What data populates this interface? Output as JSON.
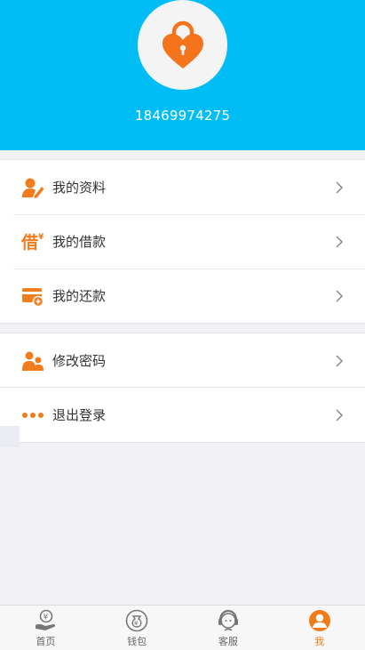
{
  "profile": {
    "phone": "18469974275",
    "avatar_icon": "heart-lock-icon"
  },
  "menu_group_1": [
    {
      "label": "我的资料",
      "icon": "user-edit-icon"
    },
    {
      "label": "我的借款",
      "icon": "borrow-icon"
    },
    {
      "label": "我的还款",
      "icon": "repay-card-icon"
    }
  ],
  "menu_group_2": [
    {
      "label": "修改密码",
      "icon": "users-icon"
    }
  ],
  "menu_group_3": [
    {
      "label": "退出登录",
      "icon": "more-dots-icon"
    }
  ],
  "tabbar": {
    "items": [
      {
        "label": "首页",
        "icon": "home-yen-hand-icon",
        "active": false
      },
      {
        "label": "钱包",
        "icon": "wallet-yen-bag-icon",
        "active": false
      },
      {
        "label": "客服",
        "icon": "service-headset-icon",
        "active": false
      },
      {
        "label": "我",
        "icon": "person-icon",
        "active": true
      }
    ]
  },
  "colors": {
    "header_bg": "#00bdf6",
    "accent": "#f07c1b",
    "page_bg": "#f2f2f6"
  }
}
